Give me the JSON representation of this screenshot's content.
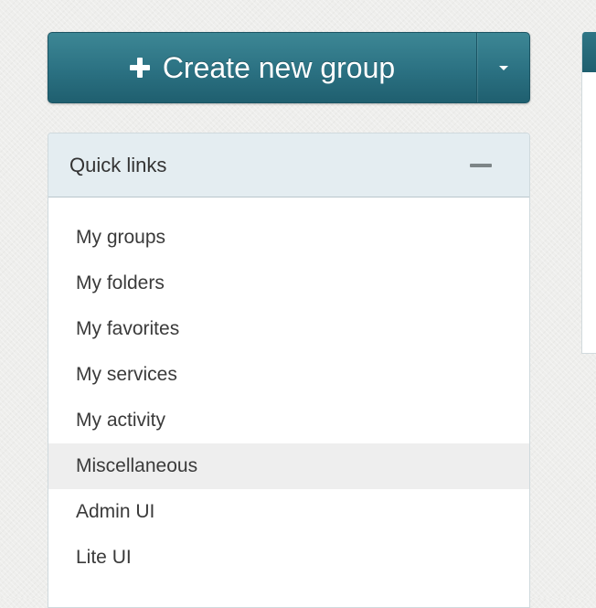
{
  "toolbar": {
    "create_label": "Create new group"
  },
  "quick_links": {
    "title": "Quick links",
    "items": [
      {
        "label": "My groups"
      },
      {
        "label": "My folders"
      },
      {
        "label": "My favorites"
      },
      {
        "label": "My services"
      },
      {
        "label": "My activity"
      },
      {
        "label": "Miscellaneous",
        "highlighted": true
      },
      {
        "label": "Admin UI"
      },
      {
        "label": "Lite UI"
      }
    ]
  },
  "colors": {
    "button_primary": "#2b7182",
    "panel_header_bg": "#e4edf1",
    "highlight_bg": "#eeeeee"
  }
}
